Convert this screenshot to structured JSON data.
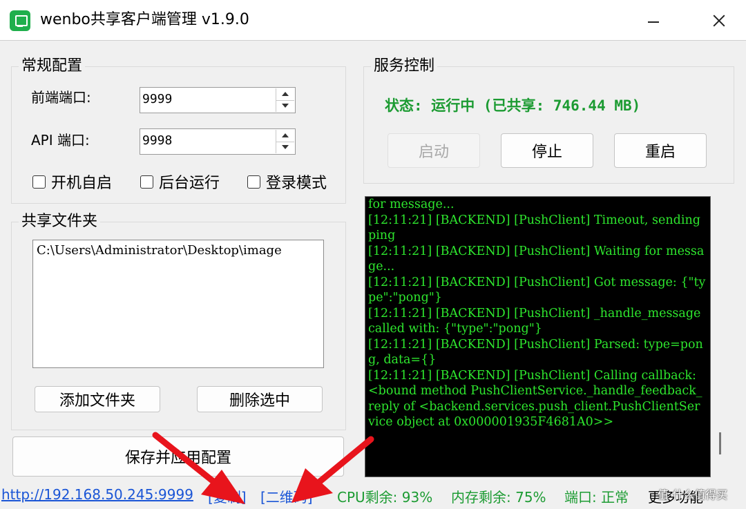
{
  "window": {
    "title": "wenbo共享客户端管理 v1.9.0"
  },
  "general": {
    "title": "常规配置",
    "frontend_port_label": "前端端口:",
    "frontend_port_value": "9999",
    "api_port_label": "API 端口:",
    "api_port_value": "9998",
    "checkbox_autostart": "开机自启",
    "checkbox_background": "后台运行",
    "checkbox_login_mode": "登录模式"
  },
  "share": {
    "title": "共享文件夹",
    "folders": [
      "C:\\Users\\Administrator\\Desktop\\image"
    ],
    "add_button": "添加文件夹",
    "delete_button": "删除选中"
  },
  "service": {
    "title": "服务控制",
    "status_text": "状态: 运行中 (已共享: 746.44 MB)",
    "start_button": "启动",
    "stop_button": "停止",
    "restart_button": "重启"
  },
  "console": {
    "log": "for message...\n[12:11:21] [BACKEND] [PushClient] Timeout, sending ping\n[12:11:21] [BACKEND] [PushClient] Waiting for message...\n[12:11:21] [BACKEND] [PushClient] Got message: {\"type\":\"pong\"}\n[12:11:21] [BACKEND] [PushClient] _handle_message called with: {\"type\":\"pong\"}\n[12:11:21] [BACKEND] [PushClient] Parsed: type=pong, data={}\n[12:11:21] [BACKEND] [PushClient] Calling callback: <bound method PushClientService._handle_feedback_reply of <backend.services.push_client.PushClientService object at 0x000001935F4681A0>>"
  },
  "save_button": "保存并应用配置",
  "footer": {
    "url": "http://192.168.50.245:9999",
    "copy_link": "[复制]",
    "qrcode_link": "[二维码]",
    "cpu": "CPU剩余: 93%",
    "memory": "内存剩余: 75%",
    "port_status": "端口: 正常",
    "more": "更多功能"
  },
  "watermark": "值 什么值得买",
  "colors": {
    "status_green": "#1c9b32",
    "console_text": "#2ee62e",
    "link_blue": "#1a55d6",
    "annotation_red": "#e8141c"
  }
}
